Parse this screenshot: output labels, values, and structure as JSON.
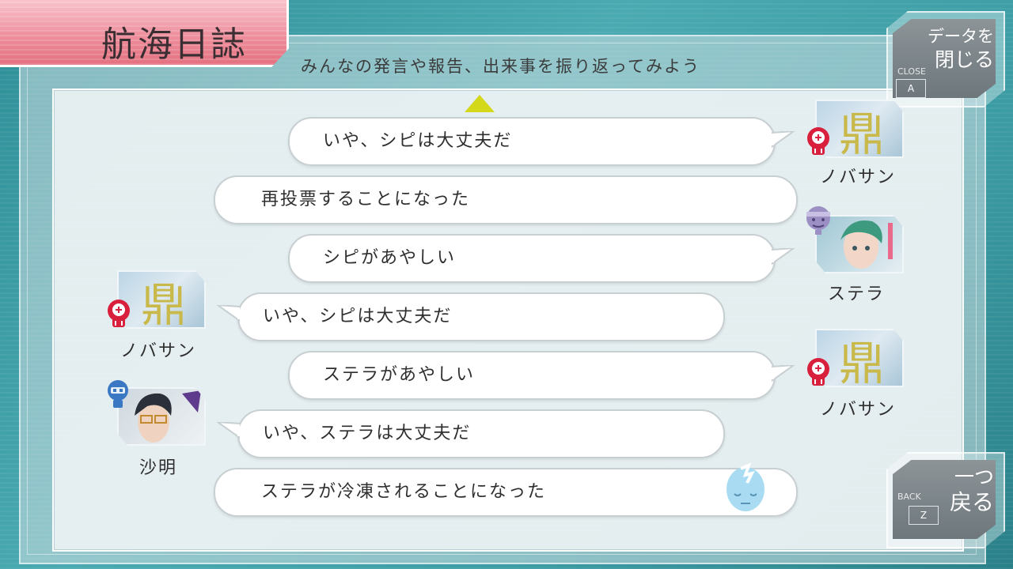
{
  "header": {
    "title": "航海日誌",
    "subtitle": "みんなの発言や報告、出来事を振り返ってみよう"
  },
  "close_button": {
    "line1": "データを",
    "line2": "閉じる",
    "small": "CLOSE",
    "key": "A"
  },
  "back_button": {
    "line1": "一つ",
    "line2": "戻る",
    "small": "BACK",
    "key": "Z"
  },
  "log": [
    {
      "side": "right",
      "speaker": "ノバサン",
      "text": "いや、シピは大丈夫だ",
      "icon": "red-skull-icon"
    },
    {
      "side": "none",
      "speaker": "",
      "text": "再投票することになった",
      "icon": ""
    },
    {
      "side": "right",
      "speaker": "ステラ",
      "text": "シピがあやしい",
      "icon": "purple-bandaged-face-icon"
    },
    {
      "side": "left",
      "speaker": "ノバサン",
      "text": "いや、シピは大丈夫だ",
      "icon": "red-skull-icon"
    },
    {
      "side": "right",
      "speaker": "ノバサン",
      "text": "ステラがあやしい",
      "icon": "red-skull-icon"
    },
    {
      "side": "left",
      "speaker": "沙明",
      "text": "いや、ステラは大丈夫だ",
      "icon": "blue-headset-icon"
    },
    {
      "side": "none",
      "speaker": "",
      "text": "ステラが冷凍されることになった",
      "icon": "frozen-head-icon"
    }
  ],
  "colors": {
    "background": "#3c9ca4",
    "title_tab": "#ee8f9d",
    "arrow": "#d4d81a",
    "skull_red": "#d81f3c",
    "bandage_purple": "#9c8fc4",
    "headset_blue": "#3a78c4"
  }
}
